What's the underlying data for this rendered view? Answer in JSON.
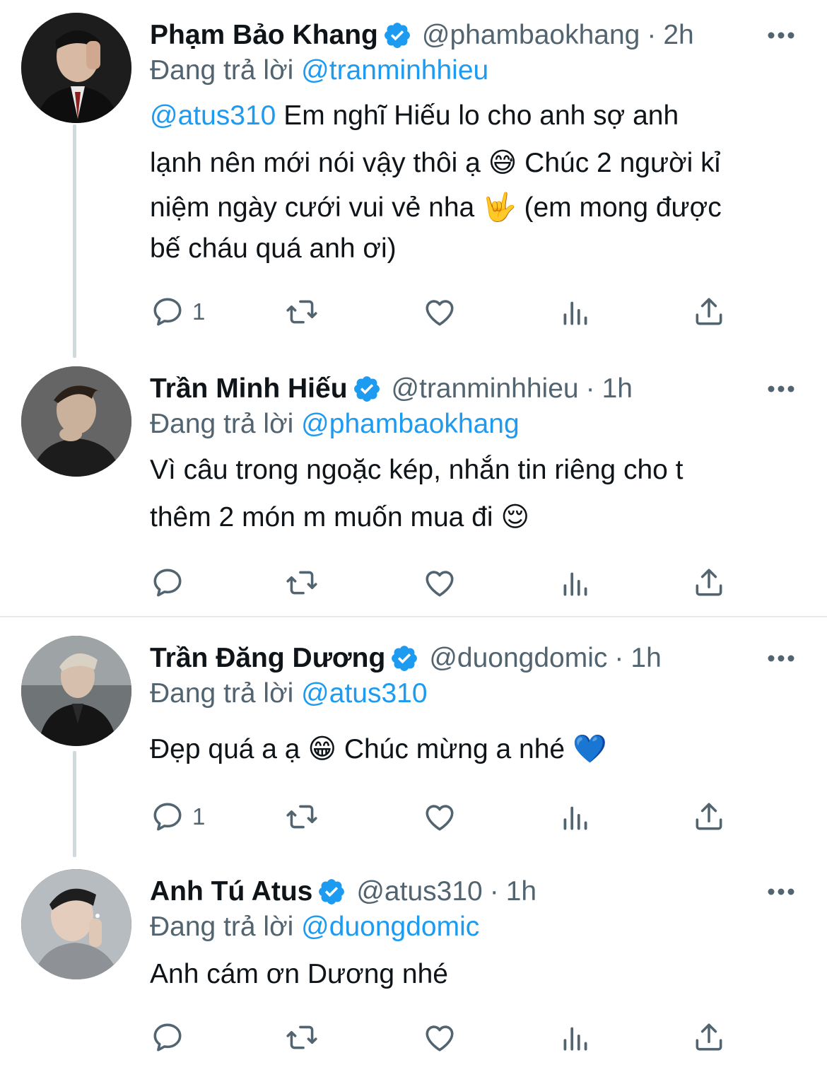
{
  "reply_prefix": "Đang trả lời",
  "tweets": [
    {
      "name": "Phạm Bảo Khang",
      "handle": "@phambaokhang",
      "dot": "·",
      "time": "2h",
      "reply_to": "@tranminhhieu",
      "body_mention": "@atus310",
      "body_lines": [
        " Em nghĩ Hiếu lo cho anh sợ anh",
        "lạnh nên mới nói vậy thôi ạ 😅  Chúc 2 người kỉ",
        "niệm ngày cưới vui vẻ nha 🤟 (em mong được",
        "bế cháu quá anh ơi)"
      ],
      "reply_count": "1",
      "avatar_icon": "avatar-photo-pham-bao-khang"
    },
    {
      "name": "Trần Minh Hiếu",
      "handle": "@tranminhhieu",
      "dot": "·",
      "time": "1h",
      "reply_to": "@phambaokhang",
      "body_lines": [
        "Vì câu trong ngoặc kép, nhắn tin riêng cho t",
        "thêm 2 món m muốn mua đi 😌"
      ],
      "reply_count": "",
      "avatar_icon": "avatar-photo-tran-minh-hieu"
    },
    {
      "name": "Trần Đăng Dương",
      "handle": "@duongdomic",
      "dot": "·",
      "time": "1h",
      "reply_to": "@atus310",
      "body_lines": [
        "Đẹp quá a ạ 😁 Chúc mừng a nhé 💙"
      ],
      "reply_count": "1",
      "avatar_icon": "avatar-photo-tran-dang-duong"
    },
    {
      "name": "Anh Tú Atus",
      "handle": "@atus310",
      "dot": "·",
      "time": "1h",
      "reply_to": "@duongdomic",
      "body_lines": [
        "Anh cám ơn Dương nhé"
      ],
      "reply_count": "",
      "avatar_icon": "avatar-photo-anh-tu-atus"
    }
  ],
  "colors": {
    "accent": "#1d9bf0",
    "secondary_text": "#536471",
    "primary_text": "#0f1419",
    "thread_line": "#cfd9de",
    "divider": "#e6ecf0"
  }
}
